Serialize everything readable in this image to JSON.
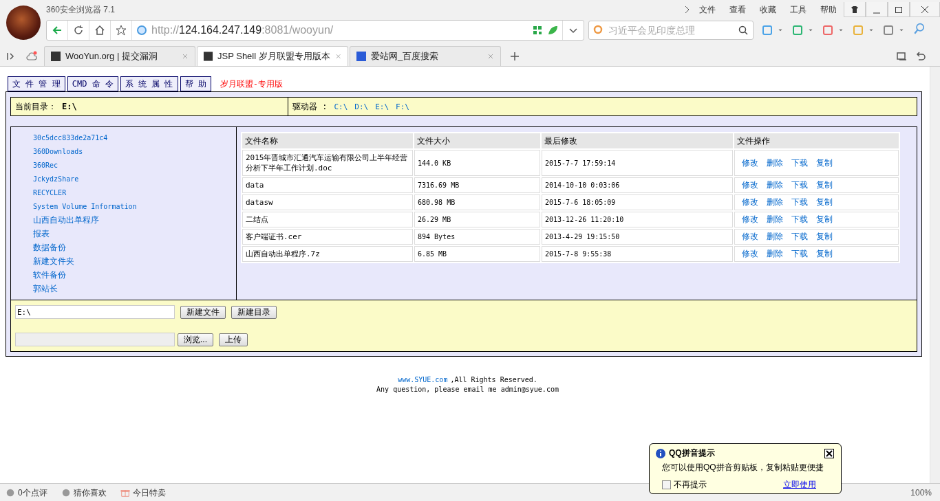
{
  "browser": {
    "title": "360安全浏览器 7.1",
    "menu": [
      "文件",
      "查看",
      "收藏",
      "工具",
      "帮助"
    ],
    "address": {
      "scheme": "http://",
      "host": "124.164.247.149",
      "rest": ":8081/wooyun/"
    },
    "search": {
      "placeholder": "习近平会见印度总理"
    },
    "tabs": [
      {
        "label": "WooYun.org | 提交漏洞",
        "selected": false
      },
      {
        "label": "JSP Shell 岁月联盟专用版本",
        "selected": true
      },
      {
        "label": "爱站网_百度搜索",
        "selected": false
      }
    ]
  },
  "nav": {
    "buttons": [
      "文 件 管 理",
      "CMD 命 令",
      "系 统 属 性",
      "帮 助"
    ],
    "brand": "岁月联盟-专用版"
  },
  "path_bar": {
    "label": "当前目录：",
    "path": "E:\\",
    "drives_label": "驱动器 :",
    "drives": [
      "C:\\",
      "D:\\",
      "E:\\",
      "F:\\"
    ]
  },
  "tree": [
    "30c5dcc833de2a71c4",
    "360Downloads",
    "360Rec",
    "JckydzShare",
    "RECYCLER",
    "System Volume Information",
    "山西自动出单程序",
    "报表",
    "数据备份",
    "新建文件夹",
    "软件备份",
    "郭站长"
  ],
  "table": {
    "columns": [
      "文件名称",
      "文件大小",
      "最后修改",
      "文件操作"
    ],
    "rows": [
      {
        "name": "2015年晋城市汇通汽车运输有限公司上半年经营分析下半年工作计划.doc",
        "size": "144.0 KB",
        "modified": "2015-7-7 17:59:14",
        "actions": [
          "修改",
          "删除",
          "下载",
          "复制"
        ]
      },
      {
        "name": "data",
        "size": "7316.69 MB",
        "modified": "2014-10-10 0:03:06",
        "actions": [
          "修改",
          "删除",
          "下载",
          "复制"
        ]
      },
      {
        "name": "datasw",
        "size": "680.98 MB",
        "modified": "2015-7-6 18:05:09",
        "actions": [
          "修改",
          "删除",
          "下载",
          "复制"
        ]
      },
      {
        "name": "二结点",
        "size": "26.29 MB",
        "modified": "2013-12-26 11:20:10",
        "actions": [
          "修改",
          "删除",
          "下载",
          "复制"
        ]
      },
      {
        "name": "客户端证书.cer",
        "size": "894 Bytes",
        "modified": "2013-4-29 19:15:50",
        "actions": [
          "修改",
          "删除",
          "下载",
          "复制"
        ]
      },
      {
        "name": "山西自动出单程序.7z",
        "size": "6.85 MB",
        "modified": "2015-7-8 9:55:38",
        "actions": [
          "修改",
          "删除",
          "下载",
          "复制"
        ]
      }
    ]
  },
  "tools": {
    "path_value": "E:\\",
    "new_file": "新建文件",
    "new_dir": "新建目录",
    "browse": "浏览...",
    "upload": "上传"
  },
  "footer": {
    "link": "www.SYUE.com",
    "rights": ",All Rights Reserved.",
    "contact": "Any question, please email me admin@syue.com"
  },
  "status_bar": {
    "items": [
      "0个点评",
      "猜你喜欢",
      "今日特卖"
    ],
    "zoom": "100%"
  },
  "popup": {
    "title": "QQ拼音提示",
    "message": "您可以使用QQ拼音剪贴板，复制粘贴更便捷",
    "checkbox": {
      "label": "不再提示",
      "checked": false
    },
    "link": "立即使用"
  }
}
